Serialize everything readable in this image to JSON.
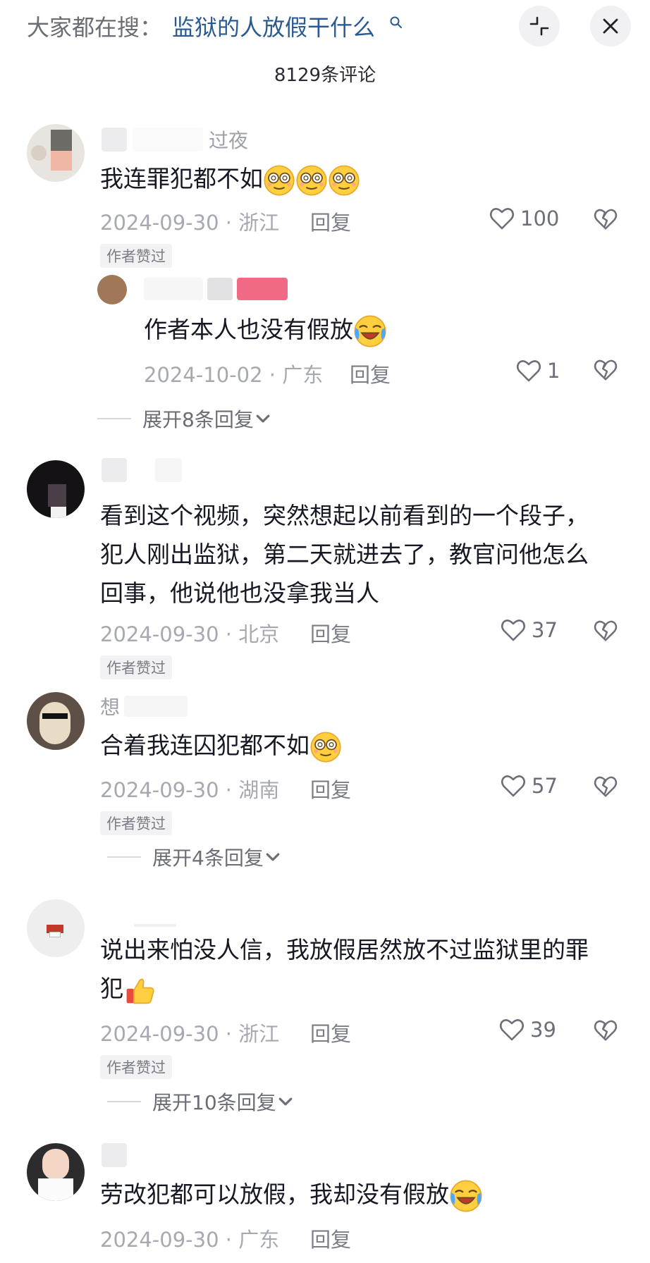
{
  "header": {
    "hint_label": "大家都在搜：",
    "hint_query": "监狱的人放假干什么",
    "comment_count": "8129条评论"
  },
  "comments": [
    {
      "name_visible": "过夜",
      "text": "我连罪犯都不如",
      "date": "2024-09-30",
      "location": "浙江",
      "reply_label": "回复",
      "likes": "100",
      "badge": "作者赞过",
      "emojis": [
        "dizzy-face-emoji",
        "dizzy-face-emoji",
        "dizzy-face-emoji"
      ],
      "sub_reply": {
        "text": "作者本人也没有假放",
        "date": "2024-10-02",
        "location": "广东",
        "reply_label": "回复",
        "likes": "1",
        "emoji": "crying-face-emoji"
      },
      "expand_label": "展开8条回复"
    },
    {
      "text_lines": [
        "看到这个视频，突然想起以前看到的一个段子，",
        "犯人刚出监狱，第二天就进去了，教官问他怎么",
        "回事，他说他也没拿我当人"
      ],
      "date": "2024-09-30",
      "location": "北京",
      "reply_label": "回复",
      "likes": "37",
      "badge": "作者赞过"
    },
    {
      "name_visible": "想",
      "text": "合着我连囚犯都不如",
      "date": "2024-09-30",
      "location": "湖南",
      "reply_label": "回复",
      "likes": "57",
      "badge": "作者赞过",
      "emoji": "dizzy-face-emoji",
      "expand_label": "展开4条回复"
    },
    {
      "text_lines": [
        "说出来怕没人信，我放假居然放不过监狱里的罪",
        "犯"
      ],
      "date": "2024-09-30",
      "location": "浙江",
      "reply_label": "回复",
      "likes": "39",
      "badge": "作者赞过",
      "emoji": "thumbs-up-emoji",
      "expand_label": "展开10条回复"
    },
    {
      "text": "劳改犯都可以放假，我却没有假放",
      "date": "2024-09-30",
      "location": "广东",
      "reply_label": "回复",
      "emoji": "crying-face-emoji"
    }
  ],
  "colors": {
    "query_blue": "#2a5a8f",
    "meta_gray": "#a7a9b1",
    "text_dark": "#161823"
  }
}
